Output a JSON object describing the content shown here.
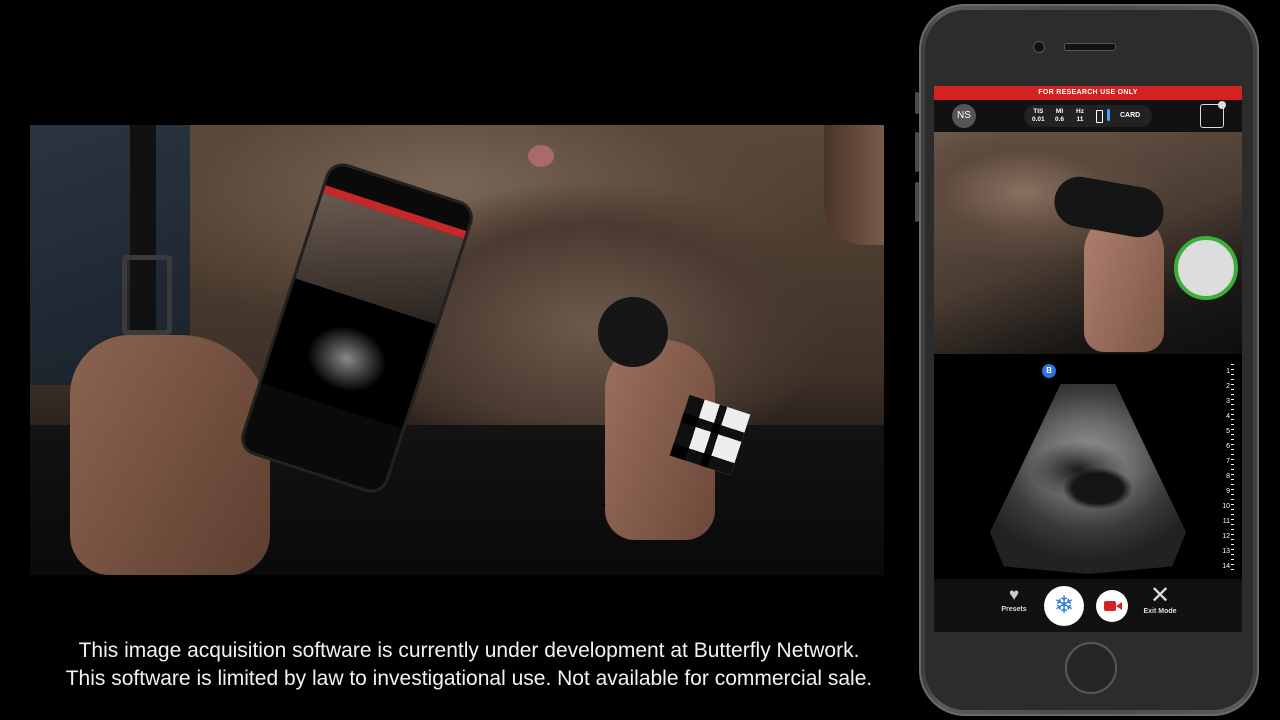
{
  "caption": {
    "line1": "This image acquisition software is currently under development at Butterfly Network.",
    "line2": "This software is limited by law to investigational use. Not available for commercial sale."
  },
  "app": {
    "banner": "FOR RESEARCH USE ONLY",
    "user_initials": "NS",
    "params": [
      {
        "label": "TIS",
        "value": "0.01"
      },
      {
        "label": "MI",
        "value": "0.6"
      },
      {
        "label": "Hz",
        "value": "11"
      }
    ],
    "preset": "CARD",
    "mode_badge": "B",
    "depth_labels": [
      "1",
      "2",
      "3",
      "4",
      "5",
      "6",
      "7",
      "8",
      "9",
      "10",
      "11",
      "12",
      "13",
      "14"
    ],
    "toolbar": {
      "presets_label": "Presets",
      "exit_label": "Exit Mode"
    }
  },
  "colors": {
    "banner": "#d32222",
    "freeze": "#2a7bd8",
    "record": "#d32222",
    "mode_badge": "#2f6fe0"
  }
}
